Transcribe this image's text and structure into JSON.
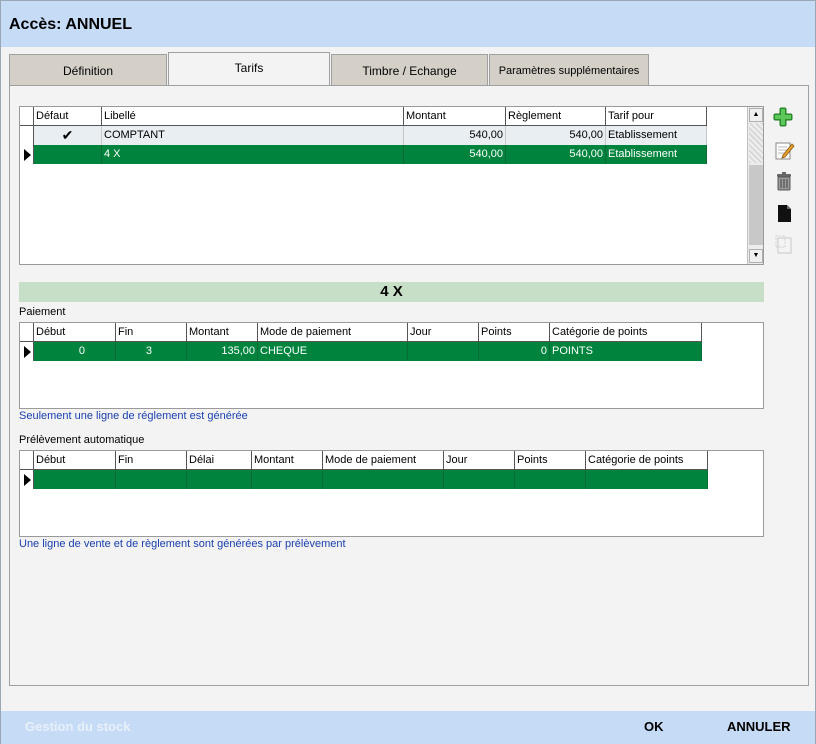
{
  "window": {
    "title": "Accès: ANNUEL"
  },
  "tabs": [
    {
      "label": "Définition"
    },
    {
      "label": "Tarifs"
    },
    {
      "label": "Timbre / Echange"
    },
    {
      "label": "Paramètres supplémentaires"
    }
  ],
  "tarifs": {
    "columns": [
      "Défaut",
      "Libellé",
      "Montant",
      "Règlement",
      "Tarif pour"
    ],
    "rows": [
      {
        "defaut": "✔",
        "libelle": "COMPTANT",
        "montant": "540,00",
        "reglement": "540,00",
        "tarif_pour": "Etablissement"
      },
      {
        "defaut": "",
        "libelle": "4 X",
        "montant": "540,00",
        "reglement": "540,00",
        "tarif_pour": "Etablissement"
      }
    ]
  },
  "actions": {
    "add": "add-icon",
    "edit": "edit-icon",
    "delete": "trash-icon",
    "copy": "copy-icon",
    "paste": "paste-icon"
  },
  "selected_banner": "4 X",
  "paiement": {
    "label": "Paiement",
    "columns": [
      "Début",
      "Fin",
      "Montant",
      "Mode de paiement",
      "Jour",
      "Points",
      "Catégorie de points"
    ],
    "rows": [
      {
        "debut": "0",
        "fin": "3",
        "montant": "135,00",
        "mode": "CHEQUE",
        "jour": "",
        "points": "0",
        "categorie": "POINTS"
      }
    ],
    "info": "Seulement une ligne de réglement est générée"
  },
  "prelevement": {
    "label": "Prélèvement automatique",
    "columns": [
      "Début",
      "Fin",
      "Délai",
      "Montant",
      "Mode de paiement",
      "Jour",
      "Points",
      "Catégorie de points"
    ],
    "info": "Une ligne de vente et de règlement sont générées par prélèvement"
  },
  "footer": {
    "stock": "Gestion du stock",
    "ok": "OK",
    "cancel": "ANNULER"
  },
  "colors": {
    "selection": "#00843d",
    "banner": "#c6dfc6",
    "titlebar": "#c5dbf6",
    "info_text": "#1a3fb0"
  }
}
